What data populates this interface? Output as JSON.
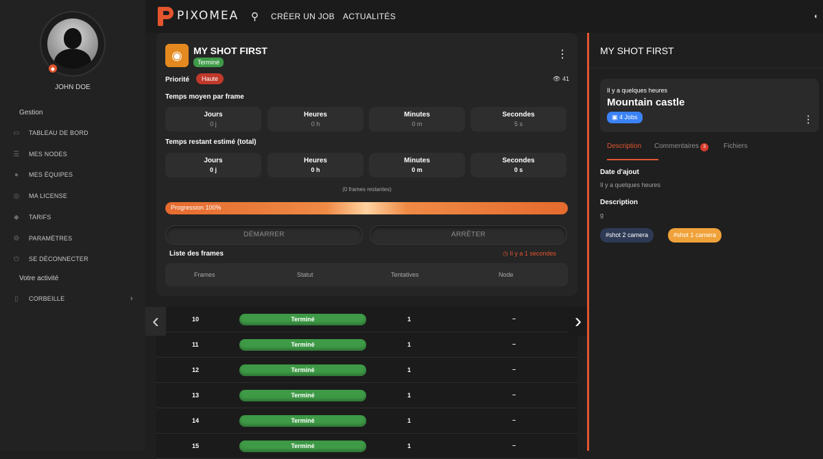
{
  "user": {
    "name": "JOHN DOE"
  },
  "sidebar": {
    "section_gestion": "Gestion",
    "items": [
      {
        "label": "TABLEAU DE BORD",
        "icon": "dashboard-icon"
      },
      {
        "label": "MES NODES",
        "icon": "server-icon"
      },
      {
        "label": "MES ÉQUIPES",
        "icon": "users-icon"
      },
      {
        "label": "MA LICENSE",
        "icon": "license-icon"
      },
      {
        "label": "TARIFS",
        "icon": "pricing-icon"
      },
      {
        "label": "PARAMÈTRES",
        "icon": "gear-icon"
      },
      {
        "label": "SE DÉCONNECTER",
        "icon": "power-icon"
      }
    ],
    "section_activity": "Votre activité",
    "trash": {
      "label": "CORBEILLE",
      "icon": "trash-icon"
    }
  },
  "topbar": {
    "brand": "PIXOMEA",
    "nav": [
      "CRÉER UN JOB",
      "ACTUALITÉS"
    ]
  },
  "job": {
    "title": "MY SHOT FIRST",
    "status": "Terminé",
    "priority_label": "Priorité",
    "priority_value": "Haute",
    "views": "41",
    "avg_title": "Temps moyen par frame",
    "avg": [
      {
        "label": "Jours",
        "value": "0 j"
      },
      {
        "label": "Heures",
        "value": "0 h"
      },
      {
        "label": "Minutes",
        "value": "0 m"
      },
      {
        "label": "Secondes",
        "value": "5 s"
      }
    ],
    "remaining_title": "Temps restant estimé (total)",
    "remaining": [
      {
        "label": "Jours",
        "value": "0 j"
      },
      {
        "label": "Heures",
        "value": "0 h"
      },
      {
        "label": "Minutes",
        "value": "0 m"
      },
      {
        "label": "Secondes",
        "value": "0 s"
      }
    ],
    "frames_left": "(0 frames restantes)",
    "progress_label": "Progression 100%",
    "progress": 1.0,
    "start_label": "DÉMARRER",
    "stop_label": "ARRÊTER",
    "frames_list_title": "Liste des frames",
    "updated_ago": "Il y a 1 secondes",
    "columns": [
      "Frames",
      "Statut",
      "Tentatives",
      "Node"
    ],
    "frames": [
      {
        "frame": "10",
        "status": "Terminé",
        "attempts": "1",
        "node": "–"
      },
      {
        "frame": "11",
        "status": "Terminé",
        "attempts": "1",
        "node": "–"
      },
      {
        "frame": "12",
        "status": "Terminé",
        "attempts": "1",
        "node": "–"
      },
      {
        "frame": "13",
        "status": "Terminé",
        "attempts": "1",
        "node": "–"
      },
      {
        "frame": "14",
        "status": "Terminé",
        "attempts": "1",
        "node": "–"
      },
      {
        "frame": "15",
        "status": "Terminé",
        "attempts": "1",
        "node": "–"
      }
    ]
  },
  "details": {
    "title": "MY SHOT FIRST",
    "scene_ago": "Il y a quelques heures",
    "scene_name": "Mountain castle",
    "jobs_badge": "4 Jobs",
    "tabs": {
      "description": "Description",
      "comments": "Commentaires",
      "comments_count": "3",
      "files": "Fichiers"
    },
    "date_label": "Date d'ajout",
    "date_value": "Il y a quelques heures",
    "desc_label": "Description",
    "desc_value": "g",
    "tags": [
      {
        "label": "#shot 2 camera",
        "color": "#2e3a55"
      },
      {
        "label": "#shot 1 camera",
        "color": "#f0a23a"
      }
    ]
  },
  "colors": {
    "accent": "#e4552e",
    "success": "#3f9a48",
    "danger": "#c0392b",
    "info": "#3b82f6"
  }
}
